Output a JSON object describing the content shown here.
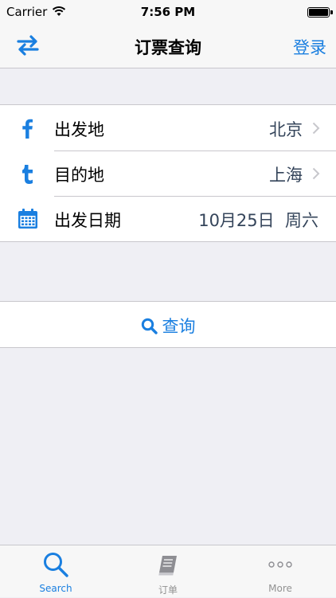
{
  "status_bar": {
    "carrier": "Carrier",
    "time": "7:56 PM",
    "icons": [
      "wifi-icon",
      "battery-icon"
    ]
  },
  "nav": {
    "title": "订票查询",
    "login_label": "登录",
    "left_icon": "swap-arrows-icon",
    "accent_color": "#1a7fe0"
  },
  "form": {
    "rows": [
      {
        "label": "出发地",
        "value": "北京",
        "icon": "facebook-icon"
      },
      {
        "label": "目的地",
        "value": "上海",
        "icon": "tumblr-icon"
      },
      {
        "label": "出发日期",
        "value": "10月25日  周六",
        "icon": "calendar-icon"
      }
    ]
  },
  "search": {
    "label": "查询",
    "icon": "search-icon"
  },
  "tab_bar": {
    "tabs": [
      {
        "label": "Search",
        "icon": "search-icon",
        "active": true
      },
      {
        "label": "订单",
        "icon": "book-icon",
        "active": false
      },
      {
        "label": "More",
        "icon": "more-dots-icon",
        "active": false
      }
    ]
  }
}
